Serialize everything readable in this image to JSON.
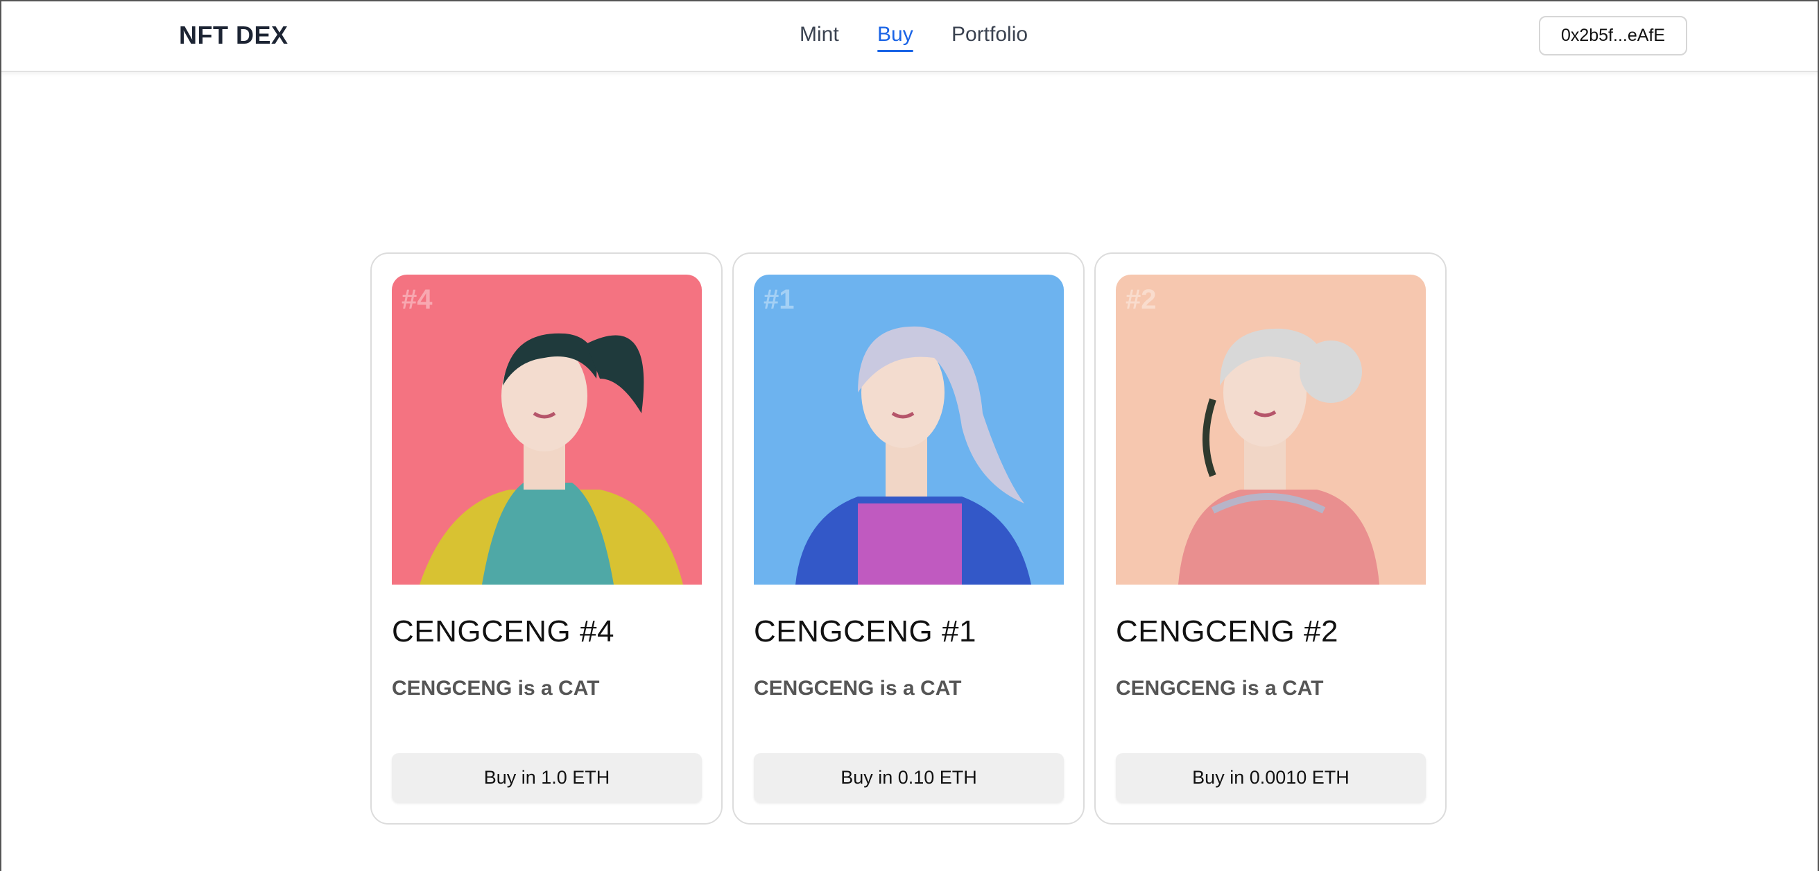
{
  "app": {
    "brand": "NFT DEX"
  },
  "nav": {
    "links": [
      {
        "label": "Mint",
        "active": false
      },
      {
        "label": "Buy",
        "active": true
      },
      {
        "label": "Portfolio",
        "active": false
      }
    ],
    "wallet_address": "0x2b5f...eAfE"
  },
  "cards": [
    {
      "id_tag": "#4",
      "title": "CENGCENG #4",
      "description": "CENGCENG is a CAT",
      "buy_label": "Buy in 1.0 ETH",
      "bg_color": "#f47381",
      "hair_color": "#1f3a3c",
      "outfit_color": "#4fa8a6",
      "accent_color": "#d8c232"
    },
    {
      "id_tag": "#1",
      "title": "CENGCENG #1",
      "description": "CENGCENG is a CAT",
      "buy_label": "Buy in 0.10 ETH",
      "bg_color": "#6db3ef",
      "hair_color": "#c9c9e0",
      "outfit_color": "#3358c8",
      "accent_color": "#c05ac0"
    },
    {
      "id_tag": "#2",
      "title": "CENGCENG #2",
      "description": "CENGCENG is a CAT",
      "buy_label": "Buy in 0.0010 ETH",
      "bg_color": "#f6c7af",
      "hair_color": "#d8d8d8",
      "outfit_color": "#e98f8f",
      "accent_color": "#b7b4c8"
    }
  ]
}
